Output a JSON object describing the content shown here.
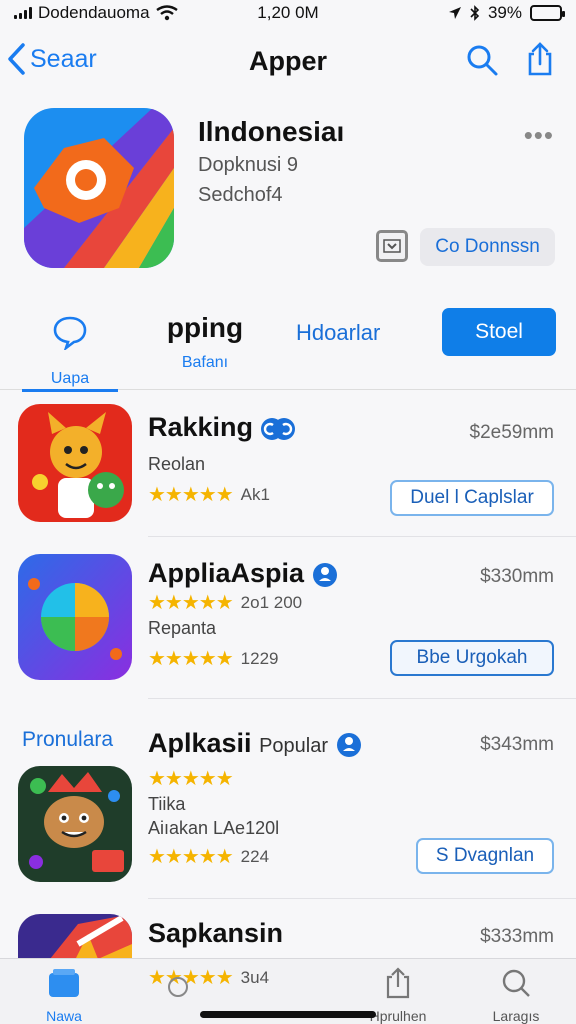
{
  "status_bar": {
    "carrier": "Dodendauoma",
    "time": "1,20 0M",
    "battery": "39%",
    "battery_level": 0.39
  },
  "nav": {
    "back_label": "Seaar",
    "title": "Apper"
  },
  "header_app": {
    "name": "Ilndonesiaı",
    "subtitle1": "Dopknusi 9",
    "subtitle2": "Sedchof4",
    "more_label": "•••",
    "connect_label": "Co Donnssn"
  },
  "tabs": {
    "home_label": "Uapa",
    "ping_big": "pping",
    "ping_small": "Bafanı",
    "hdo_label": "Hdoarlar",
    "store_label": "Stoel"
  },
  "list": [
    {
      "title": "Rakking",
      "price": "$2e59mm",
      "line1": "Reolan",
      "stars_text": "Ak1",
      "button": "Duel l Caplslar"
    },
    {
      "title": "AppliaAspia",
      "price": "$330mm",
      "stars_text1": "2o1 200",
      "line1": "Repanta",
      "stars_text2": "1229",
      "button": "Bbe Urgokah"
    },
    {
      "section_label": "Pronulara",
      "title": "Aplkasii",
      "popular": "Popular",
      "price": "$343mm",
      "line1": "Tiika",
      "line2": "Aiıakan LAe120l",
      "stars_text": "224",
      "button": "S Dvagnlan"
    },
    {
      "title": "Sapkansin",
      "price": "$333mm",
      "stars_text": "3u4"
    }
  ],
  "tab_bar": {
    "items": [
      {
        "label": "Nawa",
        "icon": "apps-icon"
      },
      {
        "label": "",
        "icon": "circle-icon"
      },
      {
        "label": "Hprulhen",
        "icon": "share-icon"
      },
      {
        "label": "Laragıs",
        "icon": "search-icon"
      }
    ]
  },
  "colors": {
    "accent": "#1a7cf0",
    "star": "#f5b400",
    "store_button": "#0f7ee8"
  }
}
